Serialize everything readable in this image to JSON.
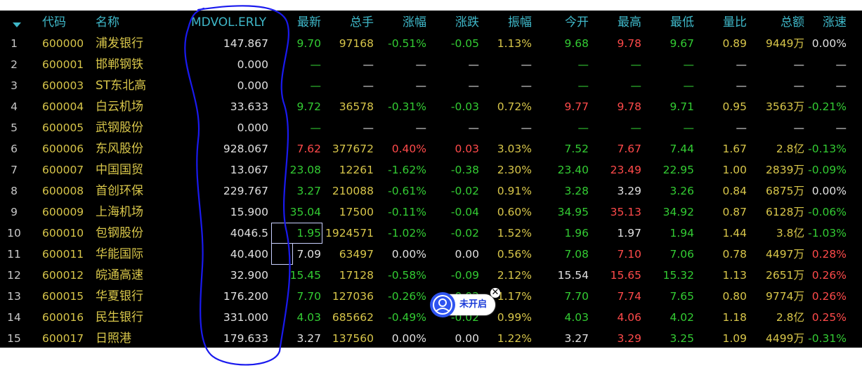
{
  "columns": {
    "code": "代码",
    "name": "名称",
    "mdvol": "MDVOL.ERLY",
    "latest": "最新",
    "volume": "总手",
    "pct": "涨幅",
    "chg": "涨跌",
    "amp": "振幅",
    "open": "今开",
    "high": "最高",
    "low": "最低",
    "ratio": "量比",
    "amount": "总额",
    "speed": "涨速"
  },
  "sort_icon": "caret-down-icon",
  "colors": {
    "up": "#ff4a4a",
    "down": "#33cc33",
    "flat": "#e0e0e0",
    "header": "#3fb8c9",
    "name": "#d8c64a",
    "annotation": "#1a1aee"
  },
  "rows": [
    {
      "num": "1",
      "code": "600000",
      "name": "浦发银行",
      "mdvol": "147.867",
      "latest": "9.70",
      "volume": "97168",
      "pct": "-0.51%",
      "chg": "-0.05",
      "amp": "1.13%",
      "open": "9.68",
      "high": "9.78",
      "low": "9.67",
      "ratio": "0.89",
      "amount": "9449万",
      "speed": "0.00%",
      "dir": {
        "latest": "dn",
        "pct": "dn",
        "chg": "dn",
        "open": "dn",
        "high": "up",
        "low": "dn",
        "speed": "eq"
      }
    },
    {
      "num": "2",
      "code": "600001",
      "name": "邯郸钢铁",
      "mdvol": "0.000",
      "latest": "—",
      "volume": "—",
      "pct": "—",
      "chg": "—",
      "amp": "—",
      "open": "—",
      "high": "—",
      "low": "—",
      "ratio": "—",
      "amount": "—",
      "speed": "—",
      "dir": {
        "latest": "dash",
        "volume": "eq",
        "pct": "eq",
        "chg": "eq",
        "amp": "eq",
        "open": "dash",
        "high": "dash",
        "low": "dash",
        "ratio": "eq",
        "amount": "eq",
        "speed": "eq"
      }
    },
    {
      "num": "3",
      "code": "600003",
      "name": "ST东北高",
      "mdvol": "0.000",
      "latest": "—",
      "volume": "—",
      "pct": "—",
      "chg": "—",
      "amp": "—",
      "open": "—",
      "high": "—",
      "low": "—",
      "ratio": "—",
      "amount": "—",
      "speed": "—",
      "dir": {
        "latest": "dash",
        "volume": "eq",
        "pct": "eq",
        "chg": "eq",
        "amp": "eq",
        "open": "dash",
        "high": "dash",
        "low": "dash",
        "ratio": "eq",
        "amount": "eq",
        "speed": "eq"
      }
    },
    {
      "num": "4",
      "code": "600004",
      "name": "白云机场",
      "mdvol": "33.633",
      "latest": "9.72",
      "volume": "36578",
      "pct": "-0.31%",
      "chg": "-0.03",
      "amp": "0.72%",
      "open": "9.77",
      "high": "9.78",
      "low": "9.71",
      "ratio": "0.95",
      "amount": "3563万",
      "speed": "-0.21%",
      "dir": {
        "latest": "dn",
        "pct": "dn",
        "chg": "dn",
        "open": "up",
        "high": "up",
        "low": "dn",
        "speed": "dn"
      }
    },
    {
      "num": "5",
      "code": "600005",
      "name": "武钢股份",
      "mdvol": "0.000",
      "latest": "—",
      "volume": "—",
      "pct": "—",
      "chg": "—",
      "amp": "—",
      "open": "—",
      "high": "—",
      "low": "—",
      "ratio": "—",
      "amount": "—",
      "speed": "—",
      "dir": {
        "latest": "dash",
        "volume": "eq",
        "pct": "eq",
        "chg": "eq",
        "amp": "eq",
        "open": "dash",
        "high": "dash",
        "low": "dash",
        "ratio": "eq",
        "amount": "eq",
        "speed": "eq"
      }
    },
    {
      "num": "6",
      "code": "600006",
      "name": "东风股份",
      "mdvol": "928.067",
      "latest": "7.62",
      "volume": "377672",
      "pct": "0.40%",
      "chg": "0.03",
      "amp": "3.03%",
      "open": "7.52",
      "high": "7.67",
      "low": "7.44",
      "ratio": "1.67",
      "amount": "2.8亿",
      "speed": "-0.13%",
      "dir": {
        "latest": "up",
        "pct": "up",
        "chg": "up",
        "open": "dn",
        "high": "up",
        "low": "dn",
        "speed": "dn"
      }
    },
    {
      "num": "7",
      "code": "600007",
      "name": "中国国贸",
      "mdvol": "13.067",
      "latest": "23.08",
      "volume": "12261",
      "pct": "-1.62%",
      "chg": "-0.38",
      "amp": "2.30%",
      "open": "23.40",
      "high": "23.49",
      "low": "22.95",
      "ratio": "1.00",
      "amount": "2839万",
      "speed": "-0.09%",
      "dir": {
        "latest": "dn",
        "pct": "dn",
        "chg": "dn",
        "open": "dn",
        "high": "up",
        "low": "dn",
        "speed": "dn"
      }
    },
    {
      "num": "8",
      "code": "600008",
      "name": "首创环保",
      "mdvol": "229.767",
      "latest": "3.27",
      "volume": "210088",
      "pct": "-0.61%",
      "chg": "-0.02",
      "amp": "0.91%",
      "open": "3.28",
      "high": "3.29",
      "low": "3.26",
      "ratio": "0.84",
      "amount": "6875万",
      "speed": "0.00%",
      "dir": {
        "latest": "dn",
        "pct": "dn",
        "chg": "dn",
        "open": "dn",
        "high": "eq",
        "low": "dn",
        "speed": "eq"
      }
    },
    {
      "num": "9",
      "code": "600009",
      "name": "上海机场",
      "mdvol": "15.900",
      "latest": "35.04",
      "volume": "17500",
      "pct": "-0.11%",
      "chg": "-0.04",
      "amp": "0.60%",
      "open": "34.95",
      "high": "35.13",
      "low": "34.92",
      "ratio": "0.87",
      "amount": "6128万",
      "speed": "-0.06%",
      "dir": {
        "latest": "dn",
        "pct": "dn",
        "chg": "dn",
        "open": "dn",
        "high": "up",
        "low": "dn",
        "speed": "dn"
      }
    },
    {
      "num": "10",
      "code": "600010",
      "name": "包钢股份",
      "mdvol": "4046.5",
      "latest": "1.95",
      "volume": "1924571",
      "pct": "-1.02%",
      "chg": "-0.02",
      "amp": "1.52%",
      "open": "1.96",
      "high": "1.97",
      "low": "1.94",
      "ratio": "1.44",
      "amount": "3.8亿",
      "speed": "-1.03%",
      "dir": {
        "latest": "dn",
        "pct": "dn",
        "chg": "dn",
        "open": "dn",
        "high": "eq",
        "low": "dn",
        "speed": "dn"
      }
    },
    {
      "num": "11",
      "code": "600011",
      "name": "华能国际",
      "mdvol": "40.400",
      "latest": "7.09",
      "volume": "63497",
      "pct": "0.00%",
      "chg": "0.00",
      "amp": "0.56%",
      "open": "7.08",
      "high": "7.10",
      "low": "7.06",
      "ratio": "0.78",
      "amount": "4497万",
      "speed": "0.28%",
      "dir": {
        "latest": "eq",
        "pct": "eq",
        "chg": "eq",
        "open": "dn",
        "high": "up",
        "low": "dn",
        "speed": "up"
      }
    },
    {
      "num": "12",
      "code": "600012",
      "name": "皖通高速",
      "mdvol": "32.900",
      "latest": "15.45",
      "volume": "17128",
      "pct": "-0.58%",
      "chg": "-0.09",
      "amp": "2.12%",
      "open": "15.54",
      "high": "15.65",
      "low": "15.32",
      "ratio": "1.13",
      "amount": "2651万",
      "speed": "0.26%",
      "dir": {
        "latest": "dn",
        "pct": "dn",
        "chg": "dn",
        "open": "eq",
        "high": "up",
        "low": "dn",
        "speed": "up"
      }
    },
    {
      "num": "13",
      "code": "600015",
      "name": "华夏银行",
      "mdvol": "176.200",
      "latest": "7.70",
      "volume": "127036",
      "pct": "-0.26%",
      "chg": "-0.02",
      "amp": "1.17%",
      "open": "7.70",
      "high": "7.74",
      "low": "7.65",
      "ratio": "0.80",
      "amount": "9774万",
      "speed": "0.26%",
      "dir": {
        "latest": "dn",
        "pct": "dn",
        "chg": "dn",
        "open": "dn",
        "high": "up",
        "low": "dn",
        "speed": "up"
      }
    },
    {
      "num": "14",
      "code": "600016",
      "name": "民生银行",
      "mdvol": "331.000",
      "latest": "4.03",
      "volume": "685662",
      "pct": "-0.49%",
      "chg": "-0.02",
      "amp": "0.99%",
      "open": "4.03",
      "high": "4.06",
      "low": "4.02",
      "ratio": "1.18",
      "amount": "2.8亿",
      "speed": "0.25%",
      "dir": {
        "latest": "dn",
        "pct": "dn",
        "chg": "dn",
        "open": "dn",
        "high": "up",
        "low": "dn",
        "speed": "up"
      }
    },
    {
      "num": "15",
      "code": "600017",
      "name": "日照港",
      "mdvol": "179.633",
      "latest": "3.27",
      "volume": "137560",
      "pct": "0.00%",
      "chg": "0.00",
      "amp": "1.22%",
      "open": "3.27",
      "high": "3.29",
      "low": "3.25",
      "ratio": "1.09",
      "amount": "4499万",
      "speed": "-0.31%",
      "dir": {
        "latest": "eq",
        "pct": "eq",
        "chg": "eq",
        "open": "eq",
        "high": "up",
        "low": "dn",
        "speed": "dn"
      }
    }
  ],
  "selection_rows": [
    "10",
    "11"
  ],
  "floating_badge": {
    "label": "未开启",
    "icon": "user-avatar-icon",
    "close_icon": "close-icon"
  },
  "annotation": {
    "shape": "hand-drawn-loop",
    "color": "#1a1aee"
  }
}
